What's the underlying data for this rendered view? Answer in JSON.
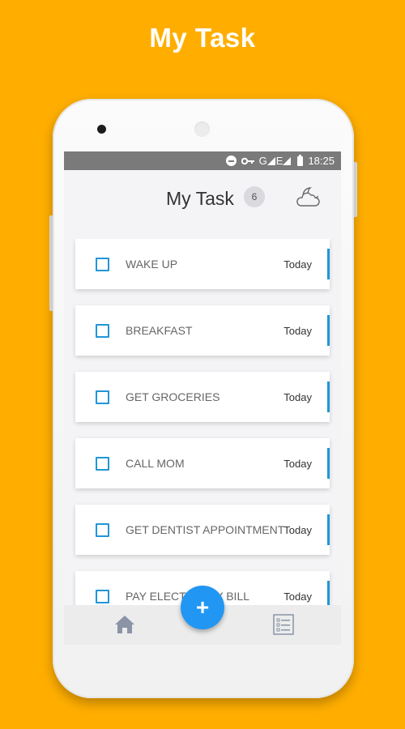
{
  "promo": {
    "title": "My Task"
  },
  "status_bar": {
    "network": "G",
    "network2": "E",
    "time": "18:25",
    "icons": [
      "minus-circle-icon",
      "key-icon",
      "signal-icon",
      "battery-icon"
    ]
  },
  "header": {
    "title": "My Task",
    "task_count": "6",
    "weather_icon": "cloud-moon-icon"
  },
  "tasks": [
    {
      "label": "WAKE UP",
      "date": "Today",
      "checked": false
    },
    {
      "label": "BREAKFAST",
      "date": "Today",
      "checked": false
    },
    {
      "label": "GET GROCERIES",
      "date": "Today",
      "checked": false
    },
    {
      "label": "CALL MOM",
      "date": "Today",
      "checked": false
    },
    {
      "label": "GET DENTIST APPOINTMENT",
      "date": "Today",
      "checked": false
    },
    {
      "label": "PAY ELECTRICITY BILL",
      "date": "Today",
      "checked": false
    }
  ],
  "fab": {
    "label": "+"
  },
  "bottom_nav": {
    "items": [
      "home-icon",
      "task-list-icon"
    ]
  },
  "colors": {
    "background": "#FFAE00",
    "accent": "#2196F3",
    "status_bar": "#7a7a7a"
  }
}
